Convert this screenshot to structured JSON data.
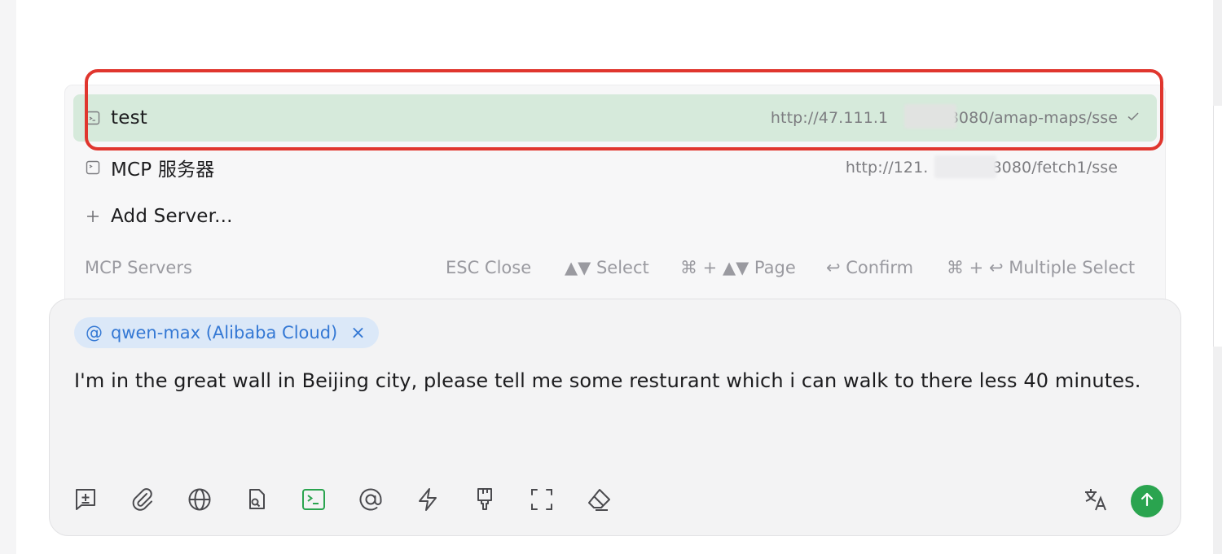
{
  "mcp_popup": {
    "servers": [
      {
        "name": "test",
        "url_prefix": "http://47.111.1",
        "url_suffix": ":8080/amap-maps/sse",
        "selected": true
      },
      {
        "name": "MCP 服务器",
        "url_prefix": "http://121.",
        "url_suffix": "8080/fetch1/sse",
        "selected": false
      }
    ],
    "add_server_label": "Add Server...",
    "footer": {
      "title": "MCP Servers",
      "esc_hint": "ESC Close",
      "select_hint": "▲▼ Select",
      "page_hint": "⌘ + ▲▼ Page",
      "confirm_hint": "↩ Confirm",
      "multi_hint": "⌘ + ↩ Multiple Select"
    }
  },
  "input": {
    "model_chip": {
      "at": "@",
      "label": "qwen-max (Alibaba Cloud)",
      "close": "×"
    },
    "message": "I'm in the great wall in Beijing city, please tell me some resturant which i can walk to there less 40 minutes."
  },
  "toolbar": {
    "icons": [
      "new-topic-icon",
      "attachment-icon",
      "globe-icon",
      "document-search-icon",
      "terminal-icon",
      "at-mention-icon",
      "lightning-icon",
      "brush-icon",
      "fullscreen-icon",
      "eraser-icon"
    ],
    "right_icons": [
      "translate-icon",
      "send-icon"
    ]
  },
  "colors": {
    "selected_row": "#d6eadb",
    "highlight_border": "#e0362e",
    "chip_bg": "#dbe8f8",
    "chip_text": "#3478d4",
    "send_button": "#2aa44f",
    "active_icon": "#2aa44f"
  }
}
